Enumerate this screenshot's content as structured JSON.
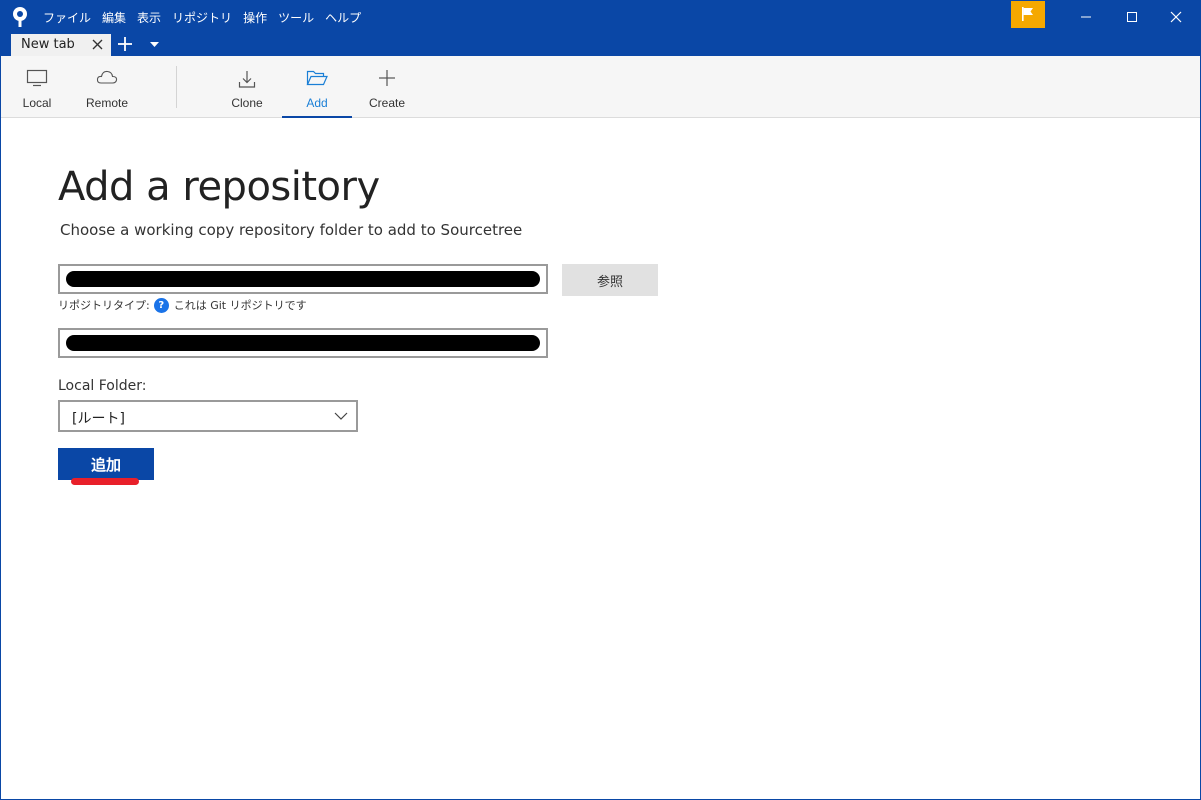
{
  "menu": {
    "items": [
      "ファイル",
      "編集",
      "表示",
      "リポジトリ",
      "操作",
      "ツール",
      "ヘルプ"
    ]
  },
  "tabs": {
    "active_label": "New tab"
  },
  "toolbar": {
    "local_label": "Local",
    "remote_label": "Remote",
    "clone_label": "Clone",
    "add_label": "Add",
    "create_label": "Create",
    "active": "Add"
  },
  "main": {
    "title": "Add a repository",
    "subtitle": "Choose a working copy repository folder to add to Sourcetree",
    "browse_label": "参照",
    "repo_type_prefix": "リポジトリタイプ:",
    "repo_type_help": "?",
    "repo_type_text": "これは Git リポジトリです",
    "local_folder_label": "Local Folder:",
    "local_folder_value": "[ルート]",
    "add_button_label": "追加"
  },
  "colors": {
    "brand": "#0a47a6",
    "flag": "#f5a800",
    "annotation": "#e8202a",
    "help_icon": "#1a73e8"
  },
  "icons": {
    "app": "sourcetree-logo-icon",
    "flag": "flag-icon",
    "local": "monitor-icon",
    "remote": "cloud-icon",
    "clone": "download-icon",
    "add": "folder-open-icon",
    "create": "plus-icon"
  }
}
